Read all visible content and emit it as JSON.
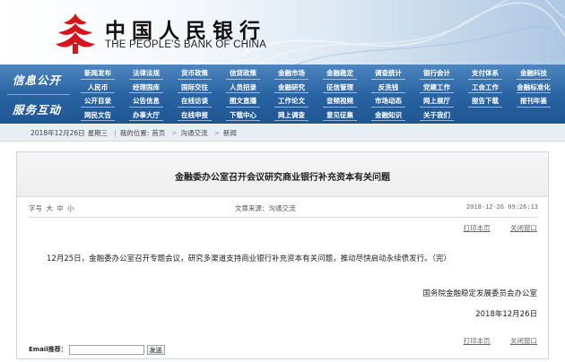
{
  "header": {
    "bank_name_cn": "中国人民银行",
    "bank_name_en": "THE PEOPLE'S BANK OF CHINA"
  },
  "nav": {
    "section_info": "信息公开",
    "section_service": "服务互动",
    "rows": [
      [
        "新闻发布",
        "法律法规",
        "货币政策",
        "信贷政策",
        "金融市场",
        "金融稳定",
        "调查统计",
        "银行会计",
        "支付体系",
        "金融科技"
      ],
      [
        "人民币",
        "经理国库",
        "国际交往",
        "人员招录",
        "金融研究",
        "征信管理",
        "反洗钱",
        "党建工作",
        "工会工作",
        "金融标准化"
      ],
      [
        "公开目录",
        "公告信息",
        "在线访谈",
        "图文直播",
        "工作论文",
        "音频视频",
        "市场动态",
        "网上展厅",
        "报告下载",
        "报刊年鉴"
      ],
      [
        "网民文告",
        "办事大厅",
        "在线申报",
        "下载中心",
        "网上调查",
        "意见征集",
        "金融知识",
        "关于我们",
        "",
        ""
      ]
    ]
  },
  "breadcrumb": {
    "date": "2018年12月26日",
    "weekday": "星期三",
    "separator": "|",
    "location_label": "我的位置:",
    "items": [
      "首页",
      "沟通交流",
      "新闻"
    ],
    "arrow": ">"
  },
  "article": {
    "title": "金融委办公室召开会议研究商业银行补充资本有关问题",
    "font_size_label": "字号",
    "font_sizes": [
      "大",
      "中",
      "小"
    ],
    "source": "文章来源：沟通交流",
    "datetime": "2018-12-26 09:26:13",
    "print_label": "打印本页",
    "close_label": "关闭窗口",
    "body": "12月25日，金融委办公室召开专题会议，研究多渠道支持商业银行补充资本有关问题，推动尽快启动永续债发行。（完）",
    "signer": "国务院金融稳定发展委员会办公室",
    "sign_date": "2018年12月26日"
  },
  "email": {
    "label": "Email推荐：",
    "value": "",
    "send_label": "发送"
  },
  "colors": {
    "nav_blue": "#2a64a3",
    "logo_red": "#d7141a",
    "crumb_bg": "#e9eef4"
  }
}
